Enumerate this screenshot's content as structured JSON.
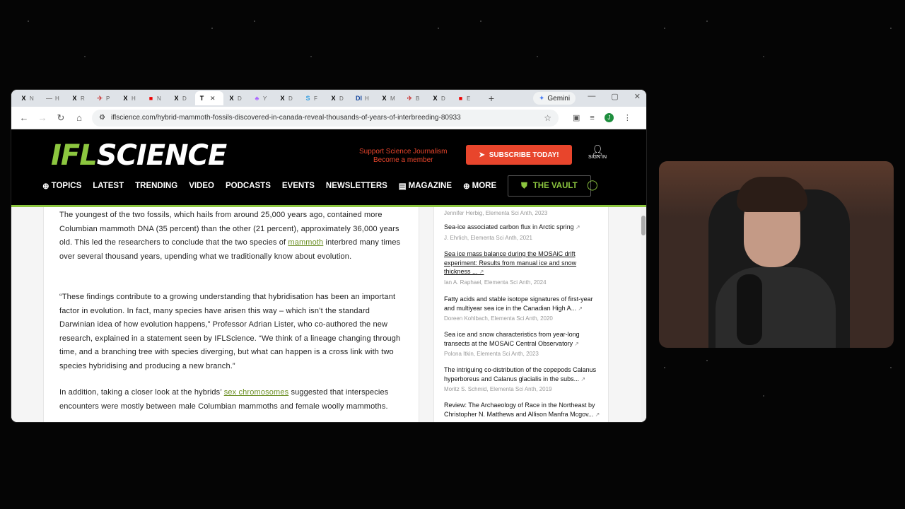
{
  "browser": {
    "tabs": [
      {
        "icon": "X",
        "title": "N",
        "color": "#000"
      },
      {
        "icon": "—",
        "title": "H",
        "color": "#888"
      },
      {
        "icon": "X",
        "title": "R",
        "color": "#000"
      },
      {
        "icon": "✈",
        "title": "P",
        "color": "#c44"
      },
      {
        "icon": "X",
        "title": "H",
        "color": "#000"
      },
      {
        "icon": "■",
        "title": "N",
        "color": "#e00"
      },
      {
        "icon": "X",
        "title": "D",
        "color": "#000"
      },
      {
        "icon": "T",
        "title": "",
        "color": "#000",
        "active": true
      },
      {
        "icon": "X",
        "title": "D",
        "color": "#000"
      },
      {
        "icon": "♣",
        "title": "Y",
        "color": "#a6f"
      },
      {
        "icon": "X",
        "title": "D",
        "color": "#000"
      },
      {
        "icon": "S",
        "title": "F",
        "color": "#3aa0e0"
      },
      {
        "icon": "X",
        "title": "D",
        "color": "#000"
      },
      {
        "icon": "DI",
        "title": "H",
        "color": "#1a4a9e"
      },
      {
        "icon": "X",
        "title": "M",
        "color": "#000"
      },
      {
        "icon": "✈",
        "title": "B",
        "color": "#c44"
      },
      {
        "icon": "X",
        "title": "D",
        "color": "#000"
      },
      {
        "icon": "■",
        "title": "E",
        "color": "#e00"
      }
    ],
    "new_tab": "+",
    "gemini_label": "Gemini",
    "url": "iflscience.com/hybrid-mammoth-fossils-discovered-in-canada-reveal-thousands-of-years-of-interbreeding-80933",
    "profile_initial": "J"
  },
  "site": {
    "logo_left": "IFL",
    "logo_right": "SCIENCE",
    "support_line1": "Support Science Journalism",
    "support_line2": "Become a member",
    "subscribe_label": "SUBSCRIBE TODAY!",
    "signin_label": "SIGN IN",
    "nav": [
      "TOPICS",
      "LATEST",
      "TRENDING",
      "VIDEO",
      "PODCASTS",
      "EVENTS",
      "NEWSLETTERS",
      "MAGAZINE",
      "MORE"
    ],
    "vault_label": "THE VAULT",
    "accent": "#8cc63f",
    "subscribe_color": "#e8452c"
  },
  "article": {
    "p1_a": "The youngest of the two fossils, which hails from around 25,000 years ago, contained more Columbian mammoth DNA (35 percent) than the other (21 percent), approximately 36,000 years old. This led the researchers to conclude that the two species of ",
    "p1_link": "mammoth",
    "p1_b": " interbred many times over several thousand years, upending what we traditionally know about evolution.",
    "p2": "“These findings contribute to a growing understanding that hybridisation has been an important factor in evolution. In fact, many species have arisen this way – which isn’t the standard Darwinian idea of how evolution happens,” Professor Adrian Lister, who co-authored the new research, explained in a statement seen by IFLScience. “We think of a lineage changing through time, and a branching tree with species diverging, but what can happen is a cross link with two species hybridising and producing a new branch.”",
    "p3_a": "In addition, taking a closer look at the hybrids’ ",
    "p3_link": "sex chromosomes",
    "p3_b": " suggested that interspecies encounters were mostly between male Columbian mammoths and female woolly mammoths."
  },
  "sidebar": {
    "top_meta": "Jennifer Herbig, Elementa Sci Anth, 2023",
    "refs": [
      {
        "title": "Sea-ice associated carbon flux in Arctic spring",
        "meta": "J. Ehrlich, Elementa Sci Anth, 2021",
        "underline": false
      },
      {
        "title": "Sea ice mass balance during the MOSAiC drift experiment: Results from manual ice and snow thickness ...",
        "meta": "Ian A. Raphael, Elementa Sci Anth, 2024",
        "underline": true
      },
      {
        "title": "Fatty acids and stable isotope signatures of first-year and multiyear sea ice in the Canadian High A...",
        "meta": "Doreen Kohlbach, Elementa Sci Anth, 2020",
        "underline": false
      },
      {
        "title": "Sea ice and snow characteristics from year-long transects at the MOSAiC Central Observatory",
        "meta": "Polona Itkin, Elementa Sci Anth, 2023",
        "underline": false
      },
      {
        "title": "The intriguing co-distribution of the copepods Calanus hyperboreus and Calanus glacialis in the subs...",
        "meta": "Moritz S. Schmid, Elementa Sci Anth, 2019",
        "underline": false
      },
      {
        "title": "Review: The Archaeology of Race in the Northeast by Christopher N. Matthews and Allison Manfra Mcgov...",
        "meta": "",
        "underline": false
      }
    ]
  }
}
